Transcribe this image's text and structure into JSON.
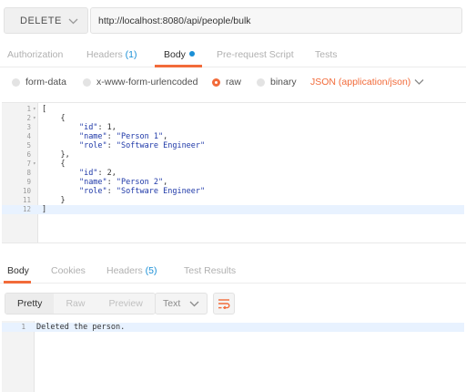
{
  "request": {
    "method": "DELETE",
    "url": "http://localhost:8080/api/people/bulk"
  },
  "request_tabs": {
    "authorization": "Authorization",
    "headers_label": "Headers",
    "headers_count": "(1)",
    "body": "Body",
    "prerequest": "Pre-request Script",
    "tests": "Tests"
  },
  "body_options": {
    "form_data": "form-data",
    "urlencoded": "x-www-form-urlencoded",
    "raw": "raw",
    "binary": "binary",
    "content_type": "JSON (application/json)",
    "selected": "raw"
  },
  "editor": {
    "lines": [
      {
        "n": "1",
        "fold": "▾",
        "t": "["
      },
      {
        "n": "2",
        "fold": "▾",
        "t": "    {"
      },
      {
        "n": "3",
        "fold": "",
        "t": "        \"id\": 1,"
      },
      {
        "n": "4",
        "fold": "",
        "t": "        \"name\": \"Person 1\","
      },
      {
        "n": "5",
        "fold": "",
        "t": "        \"role\": \"Software Engineer\""
      },
      {
        "n": "6",
        "fold": "",
        "t": "    },"
      },
      {
        "n": "7",
        "fold": "▾",
        "t": "    {"
      },
      {
        "n": "8",
        "fold": "",
        "t": "        \"id\": 2,"
      },
      {
        "n": "9",
        "fold": "",
        "t": "        \"name\": \"Person 2\","
      },
      {
        "n": "10",
        "fold": "",
        "t": "        \"role\": \"Software Engineer\""
      },
      {
        "n": "11",
        "fold": "",
        "t": "    }"
      },
      {
        "n": "12",
        "fold": "",
        "t": "]"
      }
    ],
    "current_line": "12"
  },
  "response_tabs": {
    "body": "Body",
    "cookies": "Cookies",
    "headers_label": "Headers",
    "headers_count": "(5)",
    "test_results": "Test Results"
  },
  "response_toolbar": {
    "pretty": "Pretty",
    "raw": "Raw",
    "preview": "Preview",
    "format": "Text",
    "selected_view": "Pretty"
  },
  "response_body": {
    "lines": [
      {
        "n": "1",
        "t": "Deleted the person."
      }
    ]
  },
  "colors": {
    "accent": "#f26b3a",
    "link_blue": "#1a8fd6",
    "json_blue": "#1f39a8"
  },
  "icons": {
    "method_dropdown": "chevron-down-icon",
    "content_type_dropdown": "chevron-down-icon",
    "format_dropdown": "chevron-down-icon",
    "wrap": "wrap-lines-icon"
  }
}
